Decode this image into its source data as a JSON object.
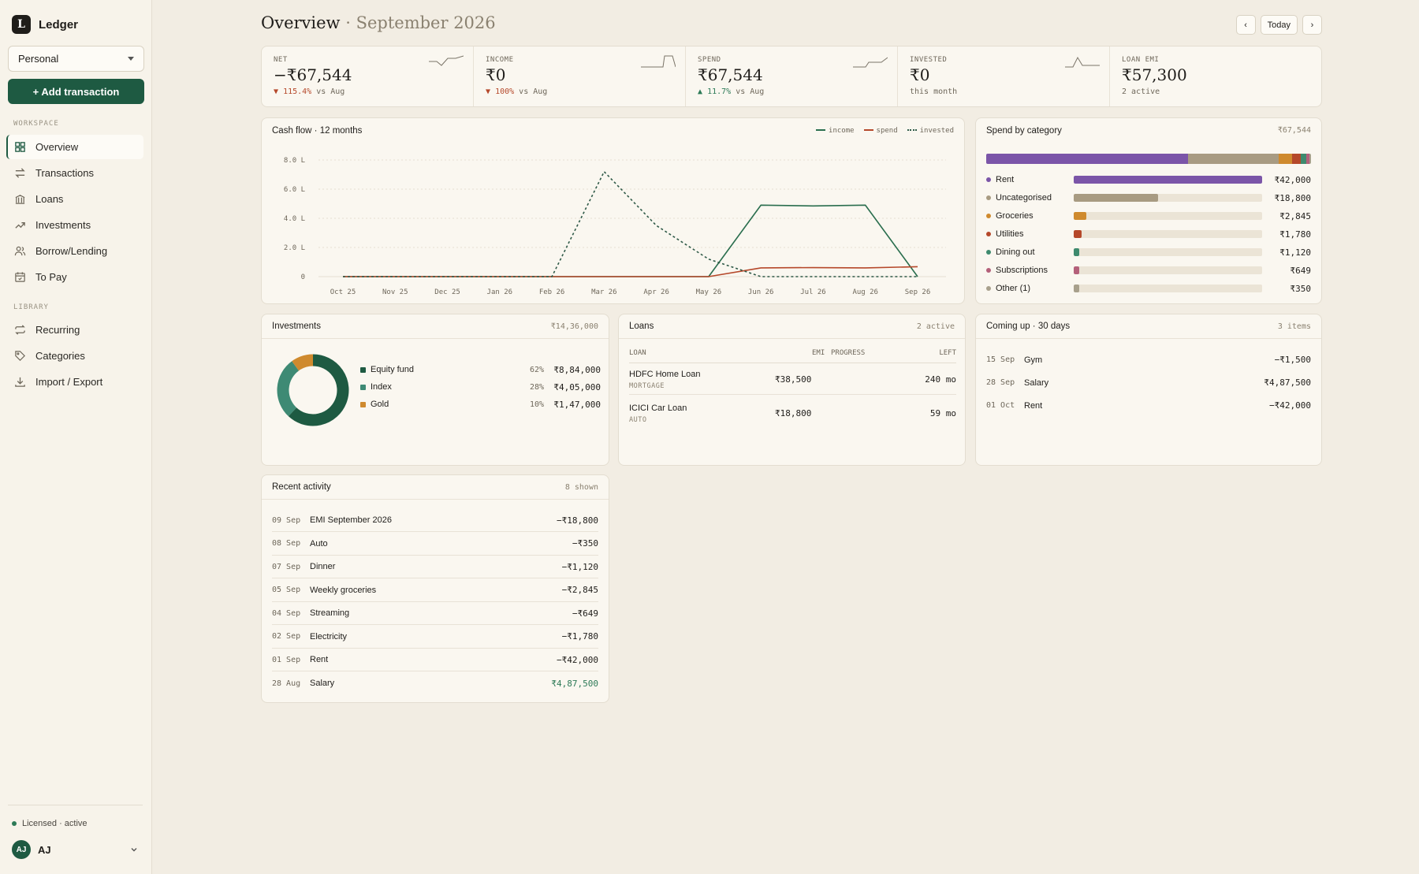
{
  "app": {
    "logo_letter": "L",
    "name": "Ledger"
  },
  "sidebar": {
    "workspace": "Personal",
    "add_label": "+ Add transaction",
    "section_workspace": "WORKSPACE",
    "section_library": "LIBRARY",
    "nav": [
      {
        "label": "Overview",
        "icon": "grid-icon"
      },
      {
        "label": "Transactions",
        "icon": "arrows-icon"
      },
      {
        "label": "Loans",
        "icon": "bank-icon"
      },
      {
        "label": "Investments",
        "icon": "trend-icon"
      },
      {
        "label": "Borrow/Lending",
        "icon": "users-icon"
      },
      {
        "label": "To Pay",
        "icon": "calendar-icon"
      }
    ],
    "library": [
      {
        "label": "Recurring",
        "icon": "repeat-icon"
      },
      {
        "label": "Categories",
        "icon": "tag-icon"
      },
      {
        "label": "Import / Export",
        "icon": "download-icon"
      }
    ],
    "license": "Licensed · active",
    "user_initials": "AJ",
    "user_name": "AJ"
  },
  "header": {
    "title": "Overview",
    "subtitle": "· September 2026",
    "prev": "‹",
    "today": "Today",
    "next": "›"
  },
  "kpis": [
    {
      "label": "NET",
      "value": "−₹67,544",
      "delta_arrow": "▼",
      "delta_value": "115.4%",
      "delta_rest": " vs Aug",
      "dir": "down"
    },
    {
      "label": "INCOME",
      "value": "₹0",
      "delta_arrow": "▼",
      "delta_value": "100%",
      "delta_rest": " vs Aug",
      "dir": "down"
    },
    {
      "label": "SPEND",
      "value": "₹67,544",
      "delta_arrow": "▲",
      "delta_value": "11.7%",
      "delta_rest": " vs Aug",
      "dir": "up"
    },
    {
      "label": "INVESTED",
      "value": "₹0",
      "delta_arrow": "",
      "delta_value": "",
      "delta_rest": "this month",
      "dir": "none"
    },
    {
      "label": "LOAN EMI",
      "value": "₹57,300",
      "delta_arrow": "",
      "delta_value": "",
      "delta_rest": "2 active",
      "dir": "none"
    }
  ],
  "cashflow": {
    "title": "Cash flow · 12 months",
    "legend": [
      "income",
      "spend",
      "invested"
    ],
    "colors": {
      "income": "#2a6e4e",
      "spend": "#b5482a",
      "invested": "#2f5a48"
    }
  },
  "chart_data": {
    "type": "line",
    "title": "Cash flow · 12 months",
    "categories": [
      "Oct 25",
      "Nov 25",
      "Dec 25",
      "Jan 26",
      "Feb 26",
      "Mar 26",
      "Apr 26",
      "May 26",
      "Jun 26",
      "Jul 26",
      "Aug 26",
      "Sep 26"
    ],
    "ylim": [
      0,
      8.0
    ],
    "yticks": [
      "0",
      "2.0 L",
      "4.0 L",
      "6.0 L",
      "8.0 L"
    ],
    "series": [
      {
        "name": "income",
        "values": [
          0,
          0,
          0,
          0,
          0,
          0,
          0,
          0,
          4.9,
          4.85,
          4.9,
          0
        ]
      },
      {
        "name": "spend",
        "values": [
          0,
          0,
          0,
          0,
          0,
          0,
          0,
          0,
          0.6,
          0.62,
          0.6,
          0.68
        ]
      },
      {
        "name": "invested",
        "values": [
          0,
          0,
          0,
          0,
          0,
          7.2,
          3.5,
          1.2,
          0,
          0,
          0,
          0
        ]
      }
    ]
  },
  "spend": {
    "title": "Spend by category",
    "total": "₹67,544",
    "categories": [
      {
        "name": "Rent",
        "amount": "₹42,000",
        "share": 0.622,
        "color": "#7b55a8"
      },
      {
        "name": "Uncategorised",
        "amount": "₹18,800",
        "share": 0.278,
        "color": "#a89b82"
      },
      {
        "name": "Groceries",
        "amount": "₹2,845",
        "share": 0.042,
        "color": "#cf8a2e"
      },
      {
        "name": "Utilities",
        "amount": "₹1,780",
        "share": 0.026,
        "color": "#b5482a"
      },
      {
        "name": "Dining out",
        "amount": "₹1,120",
        "share": 0.017,
        "color": "#3e8a6e"
      },
      {
        "name": "Subscriptions",
        "amount": "₹649",
        "share": 0.01,
        "color": "#b4607a"
      },
      {
        "name": "Other (1)",
        "amount": "₹350",
        "share": 0.005,
        "color": "#a8a08c"
      }
    ]
  },
  "investments": {
    "title": "Investments",
    "total": "₹14,36,000",
    "items": [
      {
        "name": "Equity fund",
        "pct": "62%",
        "amount": "₹8,84,000",
        "share": 0.62,
        "color": "#1e5a42"
      },
      {
        "name": "Index",
        "pct": "28%",
        "amount": "₹4,05,000",
        "share": 0.28,
        "color": "#3e8a74"
      },
      {
        "name": "Gold",
        "pct": "10%",
        "amount": "₹1,47,000",
        "share": 0.1,
        "color": "#cf8a2e"
      }
    ]
  },
  "loans": {
    "title": "Loans",
    "meta": "2 active",
    "cols": {
      "loan": "LOAN",
      "emi": "EMI",
      "progress": "PROGRESS",
      "left": "LEFT"
    },
    "rows": [
      {
        "name": "HDFC Home Loan",
        "type": "MORTGAGE",
        "emi": "₹38,500",
        "left": "240 mo"
      },
      {
        "name": "ICICI Car Loan",
        "type": "AUTO",
        "emi": "₹18,800",
        "left": "59 mo"
      }
    ]
  },
  "coming": {
    "title": "Coming up · 30 days",
    "meta": "3 items",
    "rows": [
      {
        "date": "15 Sep",
        "desc": "Gym",
        "amount": "−₹1,500",
        "pos": false
      },
      {
        "date": "28 Sep",
        "desc": "Salary",
        "amount": "₹4,87,500",
        "pos": false
      },
      {
        "date": "01 Oct",
        "desc": "Rent",
        "amount": "−₹42,000",
        "pos": false
      }
    ]
  },
  "recent": {
    "title": "Recent activity",
    "meta": "8 shown",
    "rows": [
      {
        "date": "09 Sep",
        "desc": "EMI September 2026",
        "amount": "−₹18,800",
        "pos": false
      },
      {
        "date": "08 Sep",
        "desc": "Auto",
        "amount": "−₹350",
        "pos": false
      },
      {
        "date": "07 Sep",
        "desc": "Dinner",
        "amount": "−₹1,120",
        "pos": false
      },
      {
        "date": "05 Sep",
        "desc": "Weekly groceries",
        "amount": "−₹2,845",
        "pos": false
      },
      {
        "date": "04 Sep",
        "desc": "Streaming",
        "amount": "−₹649",
        "pos": false
      },
      {
        "date": "02 Sep",
        "desc": "Electricity",
        "amount": "−₹1,780",
        "pos": false
      },
      {
        "date": "01 Sep",
        "desc": "Rent",
        "amount": "−₹42,000",
        "pos": false
      },
      {
        "date": "28 Aug",
        "desc": "Salary",
        "amount": "₹4,87,500",
        "pos": true
      }
    ]
  }
}
